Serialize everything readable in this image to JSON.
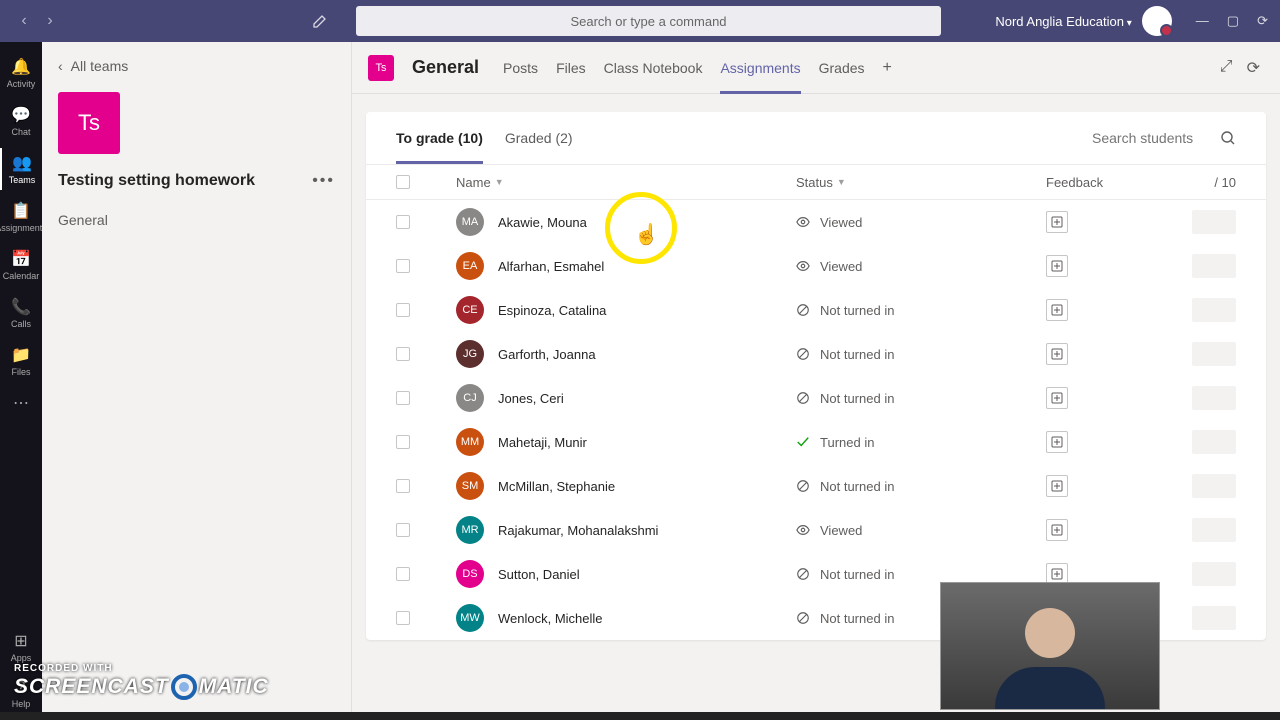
{
  "titlebar": {
    "search_placeholder": "Search or type a command",
    "org": "Nord Anglia Education"
  },
  "rail": {
    "items": [
      {
        "label": "Activity",
        "icon": "🔔"
      },
      {
        "label": "Chat",
        "icon": "💬"
      },
      {
        "label": "Teams",
        "icon": "👥",
        "active": true
      },
      {
        "label": "Assignments",
        "icon": "📋"
      },
      {
        "label": "Calendar",
        "icon": "📅"
      },
      {
        "label": "Calls",
        "icon": "📞"
      },
      {
        "label": "Files",
        "icon": "📁"
      },
      {
        "label": "",
        "icon": "⋯"
      }
    ],
    "bottom": [
      {
        "label": "Apps",
        "icon": "⊞"
      },
      {
        "label": "Help",
        "icon": "?"
      }
    ]
  },
  "leftpanel": {
    "back_label": "All teams",
    "team_initials": "Ts",
    "team_name": "Testing setting homework",
    "channels": [
      {
        "name": "General"
      }
    ]
  },
  "header": {
    "channel_initials": "Ts",
    "channel_name": "General",
    "tabs": [
      {
        "label": "Posts"
      },
      {
        "label": "Files"
      },
      {
        "label": "Class Notebook"
      },
      {
        "label": "Assignments",
        "active": true
      },
      {
        "label": "Grades"
      }
    ]
  },
  "subtabs": {
    "to_grade": "To grade (10)",
    "graded": "Graded (2)",
    "search_placeholder": "Search students"
  },
  "columns": {
    "name": "Name",
    "status": "Status",
    "feedback": "Feedback",
    "score": "/ 10"
  },
  "status_labels": {
    "viewed": "Viewed",
    "not_turned_in": "Not turned in",
    "turned_in": "Turned in"
  },
  "students": [
    {
      "initials": "MA",
      "name": "Akawie, Mouna",
      "color": "#8a8886",
      "status": "viewed"
    },
    {
      "initials": "EA",
      "name": "Alfarhan, Esmahel",
      "color": "#ca5010",
      "status": "viewed"
    },
    {
      "initials": "CE",
      "name": "Espinoza, Catalina",
      "color": "#a4262c",
      "status": "not_turned_in"
    },
    {
      "initials": "JG",
      "name": "Garforth, Joanna",
      "color": "#5c2e2e",
      "status": "not_turned_in"
    },
    {
      "initials": "CJ",
      "name": "Jones, Ceri",
      "color": "#8a8886",
      "status": "not_turned_in"
    },
    {
      "initials": "MM",
      "name": "Mahetaji, Munir",
      "color": "#ca5010",
      "status": "turned_in"
    },
    {
      "initials": "SM",
      "name": "McMillan, Stephanie",
      "color": "#ca5010",
      "status": "not_turned_in"
    },
    {
      "initials": "MR",
      "name": "Rajakumar, Mohanalakshmi",
      "color": "#038387",
      "status": "viewed"
    },
    {
      "initials": "DS",
      "name": "Sutton, Daniel",
      "color": "#e3008c",
      "status": "not_turned_in"
    },
    {
      "initials": "MW",
      "name": "Wenlock, Michelle",
      "color": "#038387",
      "status": "not_turned_in"
    }
  ],
  "watermark": {
    "small": "RECORDED WITH",
    "big_a": "SCREENCAST",
    "big_b": "MATIC"
  }
}
